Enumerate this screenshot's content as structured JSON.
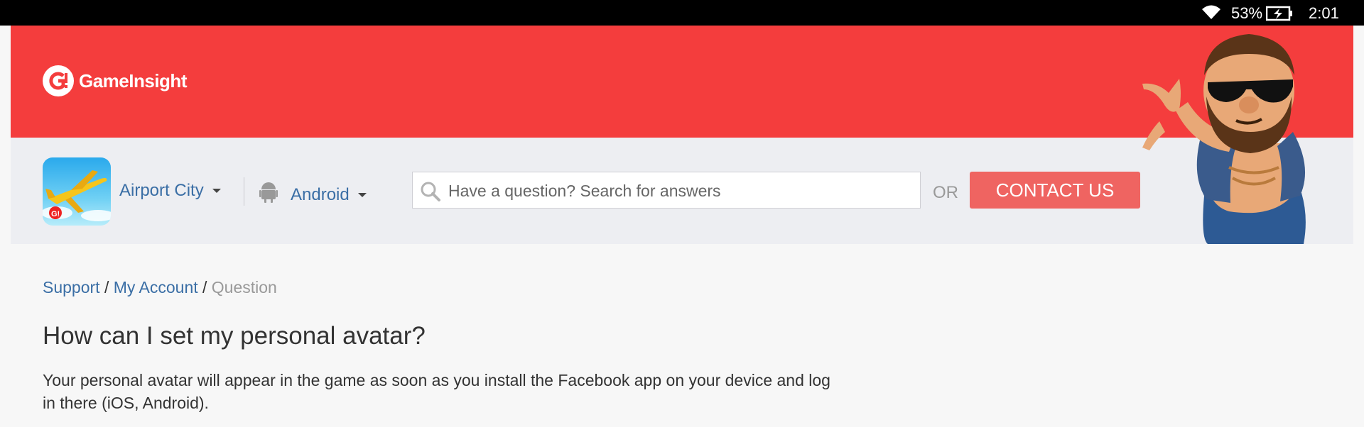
{
  "status_bar": {
    "battery_percent": "53%",
    "time": "2:01",
    "icons": [
      "wifi-icon",
      "battery-charging-icon"
    ]
  },
  "header": {
    "brand": "GameInsight",
    "accent_color": "#f43d3d"
  },
  "toolbar": {
    "game_selector": "Airport City",
    "platform_selector": "Android",
    "search_placeholder": "Have a question? Search for answers",
    "or_label": "OR",
    "contact_button": "CONTACT US",
    "contact_color": "#ef6461"
  },
  "breadcrumb": {
    "items": [
      "Support",
      "My Account"
    ],
    "separator": "/",
    "current": "Question"
  },
  "article": {
    "title": "How can I set my personal avatar?",
    "body": "Your personal avatar will appear in the game as soon as you install the Facebook app on your device and log in there (iOS, Android)."
  }
}
